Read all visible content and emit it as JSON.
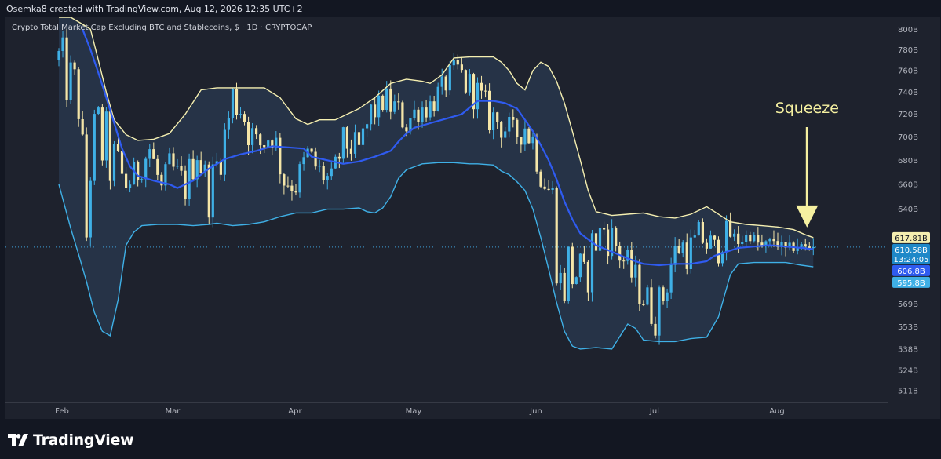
{
  "header": {
    "text": "Osemka8 created with TradingView.com, Aug 12, 2026 12:35 UTC+2"
  },
  "footer": {
    "brand": "TradingView"
  },
  "colors": {
    "background": "#131722",
    "pane": "#1e222d",
    "upper_band": "#f5efb0",
    "lower_band": "#3fb0e6",
    "basis": "#2f5bf0",
    "band_fill": "#2a3a50",
    "candle_up": "#3fb0e6",
    "candle_down": "#f5e6a8",
    "annotation": "#f5f0a0"
  },
  "chart_data": {
    "type": "candlestick",
    "title": "Crypto Total Market Cap Excluding BTC and Stablecoins, $ · 1D · CRYPTOCAP",
    "indicator": "Bollinger Bands",
    "y_scale": "log",
    "ylim": [
      504,
      812
    ],
    "x_range": [
      0,
      195
    ],
    "y_ticks": [
      "800B",
      "780B",
      "760B",
      "740B",
      "720B",
      "700B",
      "680B",
      "660B",
      "640B",
      "569B",
      "553B",
      "538B",
      "524B",
      "511B"
    ],
    "y_tick_values": [
      800,
      780,
      760,
      740,
      720,
      700,
      680,
      660,
      640,
      569,
      553,
      538,
      524,
      511
    ],
    "x_ticks": [
      {
        "label": "Feb",
        "day": 0
      },
      {
        "label": "Mar",
        "day": 28
      },
      {
        "label": "Apr",
        "day": 59
      },
      {
        "label": "May",
        "day": 89
      },
      {
        "label": "Jun",
        "day": 120
      },
      {
        "label": "Jul",
        "day": 150
      },
      {
        "label": "Aug",
        "day": 181
      }
    ],
    "price_tags": [
      {
        "lines": [
          "617.81B"
        ],
        "value": 617.81,
        "color": "#f5efb0",
        "text_color": "#131722"
      },
      {
        "lines": [
          "610.58B",
          "13:24:05"
        ],
        "value": 610.58,
        "color": "#1e88c8",
        "text_color": "#ffffff"
      },
      {
        "lines": [
          "606.8B"
        ],
        "value": 604.5,
        "color": "#2f5bf0",
        "text_color": "#ffffff"
      },
      {
        "lines": [
          "595.8B"
        ],
        "value": 595.8,
        "color": "#3fb0e6",
        "text_color": "#ffffff"
      }
    ],
    "annotation": {
      "text": "Squeeze",
      "arrow_day": 191,
      "arrow_value": 622
    },
    "last_price": 610.58,
    "closes": [
      {
        "d": 0,
        "v": 770
      },
      {
        "d": 3,
        "v": 745
      },
      {
        "d": 5,
        "v": 735
      },
      {
        "d": 7,
        "v": 620
      },
      {
        "d": 8,
        "v": 680
      },
      {
        "d": 10,
        "v": 700
      },
      {
        "d": 14,
        "v": 675
      },
      {
        "d": 17,
        "v": 660
      },
      {
        "d": 20,
        "v": 670
      },
      {
        "d": 23,
        "v": 690
      },
      {
        "d": 26,
        "v": 655
      },
      {
        "d": 28,
        "v": 675
      },
      {
        "d": 32,
        "v": 658
      },
      {
        "d": 35,
        "v": 690
      },
      {
        "d": 38,
        "v": 652
      },
      {
        "d": 42,
        "v": 700
      },
      {
        "d": 44,
        "v": 735
      },
      {
        "d": 46,
        "v": 728
      },
      {
        "d": 50,
        "v": 690
      },
      {
        "d": 54,
        "v": 705
      },
      {
        "d": 57,
        "v": 665
      },
      {
        "d": 60,
        "v": 660
      },
      {
        "d": 63,
        "v": 685
      },
      {
        "d": 66,
        "v": 670
      },
      {
        "d": 69,
        "v": 662
      },
      {
        "d": 72,
        "v": 695
      },
      {
        "d": 76,
        "v": 688
      },
      {
        "d": 79,
        "v": 720
      },
      {
        "d": 82,
        "v": 735
      },
      {
        "d": 85,
        "v": 725
      },
      {
        "d": 88,
        "v": 712
      },
      {
        "d": 91,
        "v": 725
      },
      {
        "d": 94,
        "v": 728
      },
      {
        "d": 97,
        "v": 742
      },
      {
        "d": 100,
        "v": 765
      },
      {
        "d": 103,
        "v": 748
      },
      {
        "d": 106,
        "v": 738
      },
      {
        "d": 109,
        "v": 718
      },
      {
        "d": 112,
        "v": 712
      },
      {
        "d": 115,
        "v": 700
      },
      {
        "d": 118,
        "v": 710
      },
      {
        "d": 121,
        "v": 690
      },
      {
        "d": 123,
        "v": 668
      },
      {
        "d": 125,
        "v": 645
      },
      {
        "d": 127,
        "v": 580
      },
      {
        "d": 129,
        "v": 595
      },
      {
        "d": 131,
        "v": 592
      },
      {
        "d": 133,
        "v": 580
      },
      {
        "d": 135,
        "v": 610
      },
      {
        "d": 138,
        "v": 625
      },
      {
        "d": 141,
        "v": 612
      },
      {
        "d": 144,
        "v": 595
      },
      {
        "d": 147,
        "v": 580
      },
      {
        "d": 149,
        "v": 570
      },
      {
        "d": 151,
        "v": 562
      },
      {
        "d": 153,
        "v": 575
      },
      {
        "d": 155,
        "v": 598
      },
      {
        "d": 157,
        "v": 612
      },
      {
        "d": 160,
        "v": 608
      },
      {
        "d": 163,
        "v": 618
      },
      {
        "d": 166,
        "v": 606
      },
      {
        "d": 169,
        "v": 622
      },
      {
        "d": 172,
        "v": 615
      },
      {
        "d": 175,
        "v": 620
      },
      {
        "d": 178,
        "v": 610
      },
      {
        "d": 181,
        "v": 616
      },
      {
        "d": 184,
        "v": 608
      },
      {
        "d": 187,
        "v": 612
      },
      {
        "d": 189,
        "v": 610
      },
      {
        "d": 191,
        "v": 610.58
      }
    ],
    "upper_band": [
      {
        "d": 0,
        "v": 812
      },
      {
        "d": 3,
        "v": 812
      },
      {
        "d": 6,
        "v": 805
      },
      {
        "d": 8,
        "v": 800
      },
      {
        "d": 10,
        "v": 770
      },
      {
        "d": 12,
        "v": 740
      },
      {
        "d": 14,
        "v": 715
      },
      {
        "d": 17,
        "v": 702
      },
      {
        "d": 20,
        "v": 697
      },
      {
        "d": 24,
        "v": 698
      },
      {
        "d": 28,
        "v": 703
      },
      {
        "d": 32,
        "v": 720
      },
      {
        "d": 36,
        "v": 742
      },
      {
        "d": 40,
        "v": 744
      },
      {
        "d": 48,
        "v": 744
      },
      {
        "d": 52,
        "v": 744
      },
      {
        "d": 56,
        "v": 735
      },
      {
        "d": 60,
        "v": 716
      },
      {
        "d": 63,
        "v": 711
      },
      {
        "d": 66,
        "v": 715
      },
      {
        "d": 70,
        "v": 715
      },
      {
        "d": 73,
        "v": 720
      },
      {
        "d": 76,
        "v": 725
      },
      {
        "d": 80,
        "v": 735
      },
      {
        "d": 84,
        "v": 748
      },
      {
        "d": 88,
        "v": 752
      },
      {
        "d": 92,
        "v": 750
      },
      {
        "d": 94,
        "v": 748
      },
      {
        "d": 97,
        "v": 756
      },
      {
        "d": 100,
        "v": 772
      },
      {
        "d": 104,
        "v": 773
      },
      {
        "d": 110,
        "v": 773
      },
      {
        "d": 112,
        "v": 768
      },
      {
        "d": 114,
        "v": 760
      },
      {
        "d": 116,
        "v": 748
      },
      {
        "d": 118,
        "v": 742
      },
      {
        "d": 120,
        "v": 760
      },
      {
        "d": 122,
        "v": 768
      },
      {
        "d": 124,
        "v": 764
      },
      {
        "d": 126,
        "v": 750
      },
      {
        "d": 128,
        "v": 730
      },
      {
        "d": 130,
        "v": 705
      },
      {
        "d": 132,
        "v": 680
      },
      {
        "d": 134,
        "v": 655
      },
      {
        "d": 136,
        "v": 638
      },
      {
        "d": 140,
        "v": 635
      },
      {
        "d": 144,
        "v": 636
      },
      {
        "d": 148,
        "v": 637
      },
      {
        "d": 152,
        "v": 634
      },
      {
        "d": 156,
        "v": 633
      },
      {
        "d": 160,
        "v": 636
      },
      {
        "d": 164,
        "v": 642
      },
      {
        "d": 166,
        "v": 638
      },
      {
        "d": 170,
        "v": 630
      },
      {
        "d": 174,
        "v": 628
      },
      {
        "d": 178,
        "v": 627
      },
      {
        "d": 182,
        "v": 626
      },
      {
        "d": 186,
        "v": 624
      },
      {
        "d": 189,
        "v": 620
      },
      {
        "d": 191,
        "v": 617.81
      }
    ],
    "lower_band": [
      {
        "d": 0,
        "v": 660
      },
      {
        "d": 3,
        "v": 625
      },
      {
        "d": 5,
        "v": 605
      },
      {
        "d": 7,
        "v": 585
      },
      {
        "d": 9,
        "v": 563
      },
      {
        "d": 11,
        "v": 550
      },
      {
        "d": 13,
        "v": 547
      },
      {
        "d": 15,
        "v": 572
      },
      {
        "d": 17,
        "v": 612
      },
      {
        "d": 19,
        "v": 622
      },
      {
        "d": 21,
        "v": 627
      },
      {
        "d": 25,
        "v": 628
      },
      {
        "d": 30,
        "v": 628
      },
      {
        "d": 34,
        "v": 627
      },
      {
        "d": 38,
        "v": 628
      },
      {
        "d": 40,
        "v": 629
      },
      {
        "d": 44,
        "v": 627
      },
      {
        "d": 48,
        "v": 628
      },
      {
        "d": 52,
        "v": 630
      },
      {
        "d": 56,
        "v": 634
      },
      {
        "d": 60,
        "v": 637
      },
      {
        "d": 64,
        "v": 637
      },
      {
        "d": 68,
        "v": 640
      },
      {
        "d": 72,
        "v": 640
      },
      {
        "d": 76,
        "v": 641
      },
      {
        "d": 78,
        "v": 638
      },
      {
        "d": 80,
        "v": 637
      },
      {
        "d": 82,
        "v": 641
      },
      {
        "d": 84,
        "v": 650
      },
      {
        "d": 86,
        "v": 665
      },
      {
        "d": 88,
        "v": 672
      },
      {
        "d": 92,
        "v": 677
      },
      {
        "d": 96,
        "v": 678
      },
      {
        "d": 100,
        "v": 678
      },
      {
        "d": 104,
        "v": 677
      },
      {
        "d": 106,
        "v": 677
      },
      {
        "d": 110,
        "v": 676
      },
      {
        "d": 112,
        "v": 671
      },
      {
        "d": 114,
        "v": 668
      },
      {
        "d": 116,
        "v": 662
      },
      {
        "d": 118,
        "v": 655
      },
      {
        "d": 120,
        "v": 640
      },
      {
        "d": 122,
        "v": 618
      },
      {
        "d": 124,
        "v": 594
      },
      {
        "d": 126,
        "v": 570
      },
      {
        "d": 128,
        "v": 550
      },
      {
        "d": 130,
        "v": 540
      },
      {
        "d": 132,
        "v": 538
      },
      {
        "d": 136,
        "v": 539
      },
      {
        "d": 140,
        "v": 538
      },
      {
        "d": 144,
        "v": 555
      },
      {
        "d": 146,
        "v": 552
      },
      {
        "d": 148,
        "v": 544
      },
      {
        "d": 152,
        "v": 543
      },
      {
        "d": 156,
        "v": 543
      },
      {
        "d": 160,
        "v": 545
      },
      {
        "d": 164,
        "v": 546
      },
      {
        "d": 167,
        "v": 560
      },
      {
        "d": 170,
        "v": 590
      },
      {
        "d": 172,
        "v": 598
      },
      {
        "d": 176,
        "v": 599
      },
      {
        "d": 180,
        "v": 599
      },
      {
        "d": 184,
        "v": 599
      },
      {
        "d": 188,
        "v": 597
      },
      {
        "d": 191,
        "v": 595.8
      }
    ],
    "basis": [
      {
        "d": 6,
        "v": 800
      },
      {
        "d": 8,
        "v": 780
      },
      {
        "d": 10,
        "v": 758
      },
      {
        "d": 12,
        "v": 735
      },
      {
        "d": 14,
        "v": 712
      },
      {
        "d": 16,
        "v": 690
      },
      {
        "d": 18,
        "v": 675
      },
      {
        "d": 20,
        "v": 667
      },
      {
        "d": 24,
        "v": 663
      },
      {
        "d": 28,
        "v": 660
      },
      {
        "d": 30,
        "v": 657
      },
      {
        "d": 34,
        "v": 663
      },
      {
        "d": 38,
        "v": 673
      },
      {
        "d": 42,
        "v": 681
      },
      {
        "d": 46,
        "v": 685
      },
      {
        "d": 50,
        "v": 688
      },
      {
        "d": 54,
        "v": 692
      },
      {
        "d": 58,
        "v": 691
      },
      {
        "d": 62,
        "v": 690
      },
      {
        "d": 64,
        "v": 683
      },
      {
        "d": 68,
        "v": 680
      },
      {
        "d": 72,
        "v": 677
      },
      {
        "d": 76,
        "v": 679
      },
      {
        "d": 80,
        "v": 683
      },
      {
        "d": 84,
        "v": 688
      },
      {
        "d": 86,
        "v": 696
      },
      {
        "d": 88,
        "v": 703
      },
      {
        "d": 90,
        "v": 708
      },
      {
        "d": 94,
        "v": 712
      },
      {
        "d": 98,
        "v": 716
      },
      {
        "d": 102,
        "v": 720
      },
      {
        "d": 106,
        "v": 732
      },
      {
        "d": 110,
        "v": 732
      },
      {
        "d": 113,
        "v": 730
      },
      {
        "d": 116,
        "v": 725
      },
      {
        "d": 118,
        "v": 715
      },
      {
        "d": 120,
        "v": 705
      },
      {
        "d": 122,
        "v": 693
      },
      {
        "d": 124,
        "v": 680
      },
      {
        "d": 126,
        "v": 664
      },
      {
        "d": 128,
        "v": 646
      },
      {
        "d": 130,
        "v": 632
      },
      {
        "d": 132,
        "v": 621
      },
      {
        "d": 136,
        "v": 612
      },
      {
        "d": 140,
        "v": 607
      },
      {
        "d": 144,
        "v": 602
      },
      {
        "d": 146,
        "v": 600
      },
      {
        "d": 148,
        "v": 598
      },
      {
        "d": 152,
        "v": 597
      },
      {
        "d": 156,
        "v": 598
      },
      {
        "d": 160,
        "v": 598
      },
      {
        "d": 164,
        "v": 600
      },
      {
        "d": 166,
        "v": 604
      },
      {
        "d": 170,
        "v": 608
      },
      {
        "d": 172,
        "v": 610
      },
      {
        "d": 176,
        "v": 611
      },
      {
        "d": 180,
        "v": 612
      },
      {
        "d": 184,
        "v": 611
      },
      {
        "d": 188,
        "v": 610
      },
      {
        "d": 191,
        "v": 609
      }
    ]
  }
}
